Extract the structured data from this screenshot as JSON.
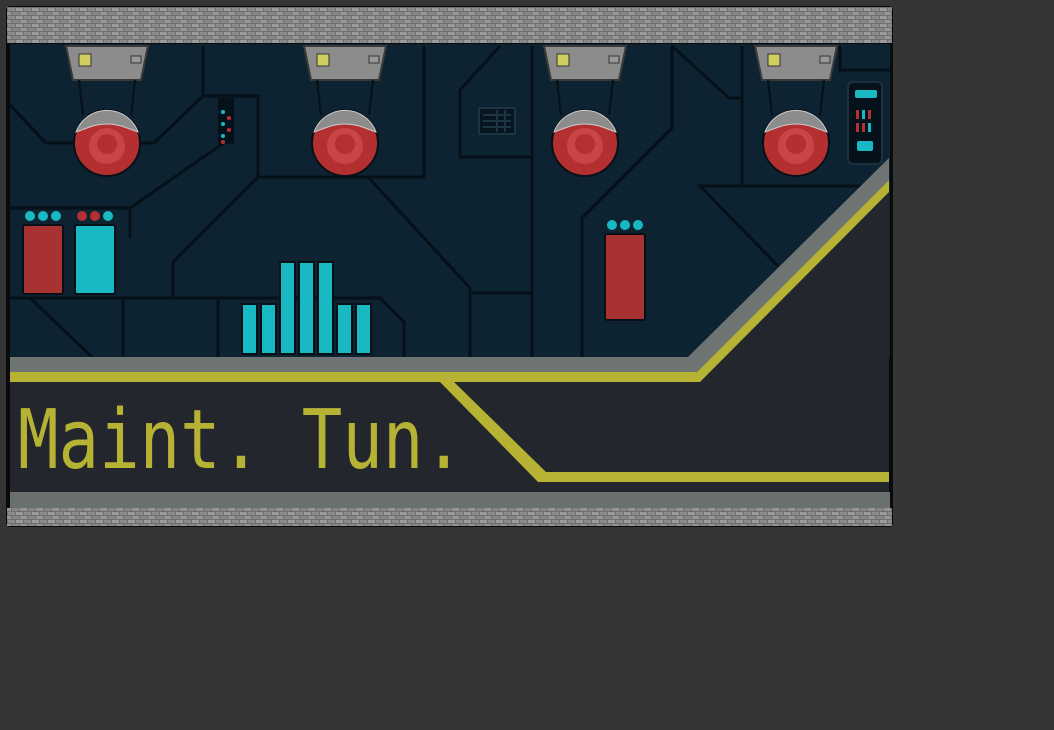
{
  "location": {
    "name": "Maint. Tun."
  },
  "colors": {
    "page_background": "#353535",
    "stone_border": "#7d7d7d",
    "wall": "#0d2331",
    "wall_lines": "#051018",
    "floor": "#23272d",
    "floor_edge": "#6e7474",
    "stripe_yellow": "#b6b233",
    "lamp_red": "#b43030",
    "lamp_hood": "#8c8c8c",
    "cyan": "#19b9c4",
    "red_panel": "#a83232"
  },
  "icons": {
    "ceiling_lamp": "ceiling-lamp-icon",
    "control_panel": "control-panel-icon",
    "vent_grate": "vent-grate-icon"
  }
}
